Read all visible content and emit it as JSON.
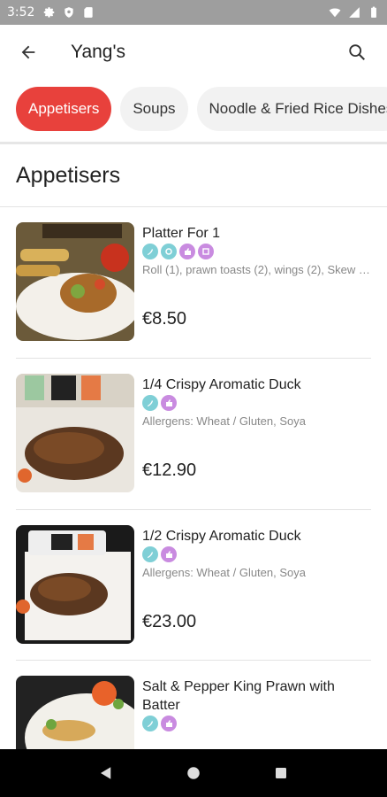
{
  "status_bar": {
    "time": "3:52",
    "left_icons": [
      "gear-icon",
      "shield-icon",
      "sd-card-icon"
    ],
    "right_icons": [
      "wifi-icon",
      "signal-icon",
      "battery-icon"
    ]
  },
  "app_bar": {
    "title": "Yang's",
    "back_icon": "arrow-left-icon",
    "search_icon": "search-icon"
  },
  "tabs": [
    {
      "label": "Appetisers",
      "active": true
    },
    {
      "label": "Soups",
      "active": false
    },
    {
      "label": "Noodle & Fried Rice Dishes",
      "active": false
    }
  ],
  "section": {
    "title": "Appetisers"
  },
  "items": [
    {
      "name": "Platter For 1",
      "badges": [
        "spicy",
        "chef-special",
        "popular",
        "combo"
      ],
      "description": "Roll (1), prawn toasts (2), wings (2), Skew (...",
      "price": "€8.50"
    },
    {
      "name": "1/4 Crispy Aromatic Duck",
      "badges": [
        "spicy",
        "popular"
      ],
      "description": "Allergens: Wheat / Gluten, Soya",
      "price": "€12.90"
    },
    {
      "name": "1/2 Crispy Aromatic Duck",
      "badges": [
        "spicy",
        "popular"
      ],
      "description": "Allergens: Wheat / Gluten, Soya",
      "price": "€23.00"
    },
    {
      "name": "Salt & Pepper King Prawn with Batter",
      "badges": [
        "spicy",
        "popular"
      ],
      "description": "",
      "price": ""
    }
  ],
  "colors": {
    "accent": "#e8413c",
    "badge_teal": "#7fcfd6",
    "badge_purple": "#c98be0",
    "status_bar": "#9e9e9e",
    "nav_bar": "#000000"
  },
  "nav_bar": {
    "buttons": [
      "back-triangle-icon",
      "home-circle-icon",
      "recents-square-icon"
    ]
  }
}
